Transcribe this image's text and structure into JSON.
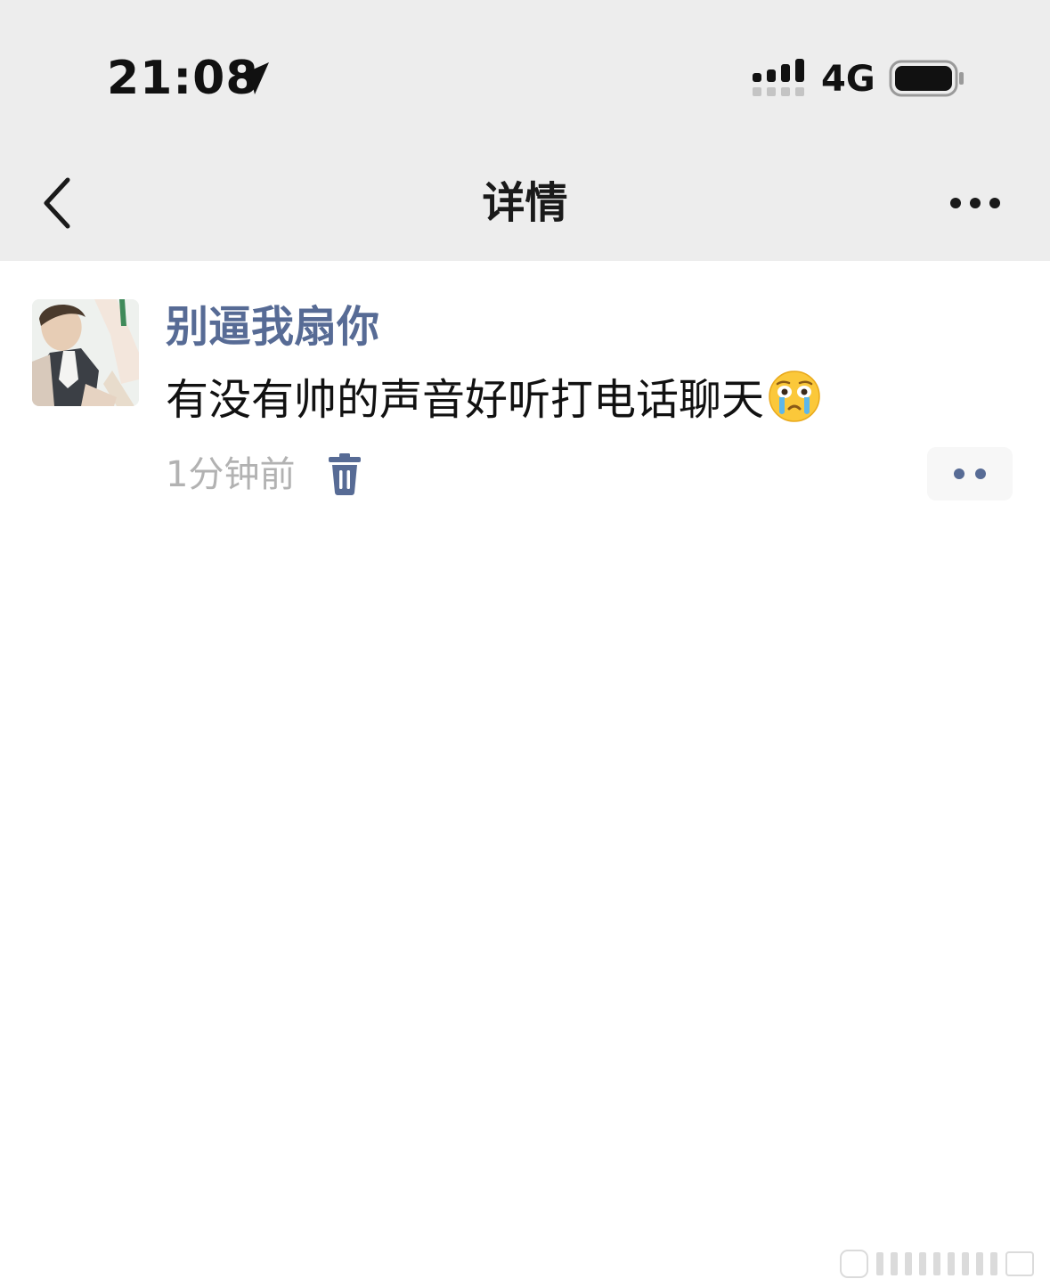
{
  "status_bar": {
    "time": "21:08",
    "network": "4G",
    "icons": [
      "location-arrow-icon",
      "signal-icon",
      "battery-icon"
    ]
  },
  "nav": {
    "title": "详情",
    "back_icon": "chevron-left-icon",
    "more_icon": "more-dots-icon"
  },
  "post": {
    "username": "别逼我扇你",
    "text": "有没有帅的声音好听打电话聊天",
    "emoji": "crying-face-icon",
    "timestamp": "1分钟前",
    "delete_icon": "trash-icon",
    "action_icon": "two-dots-icon"
  },
  "colors": {
    "nav_background": "#ededed",
    "link_blue": "#576b95",
    "timestamp_gray": "#b2b2b2",
    "text": "#111111"
  }
}
